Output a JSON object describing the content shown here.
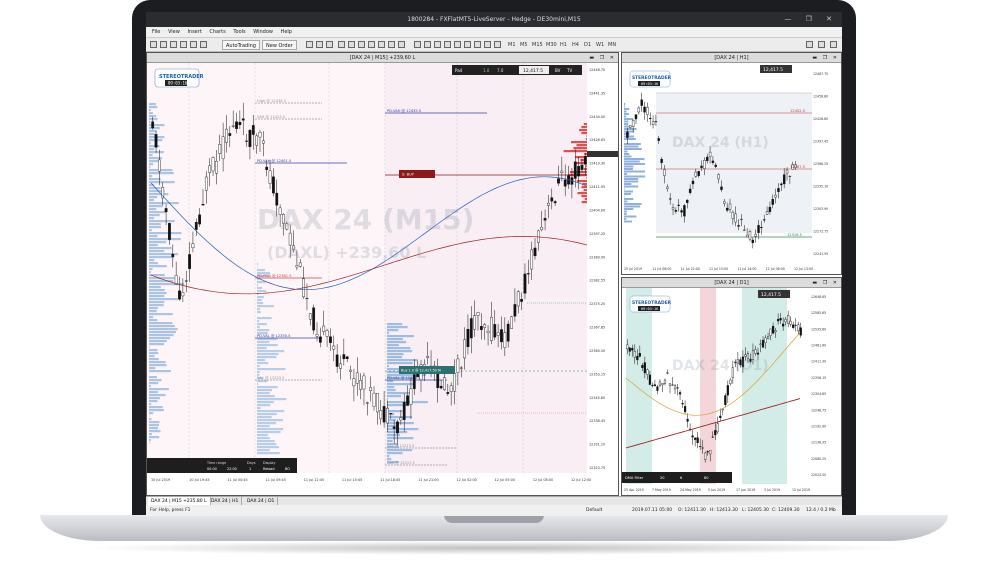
{
  "window": {
    "title": "1800284 - FXFlatMT5-LiveServer - Hedge - DE30mini,M15"
  },
  "menu": [
    "File",
    "View",
    "Insert",
    "Charts",
    "Tools",
    "Window",
    "Help"
  ],
  "toolbar": {
    "autotrading": "AutoTrading",
    "new_order": "New Order",
    "timeframes": [
      "M1",
      "M5",
      "M15",
      "M30",
      "H1",
      "H4",
      "D1",
      "W1",
      "MN"
    ]
  },
  "main_chart": {
    "header": "[DAX 24 | M15] +239,60 L",
    "watermark_line1": "DAX 24 (M15)",
    "watermark_line2": "(DAXL) +239,60 L",
    "logo": "STEREOTRADER",
    "timer": "09:03:16",
    "levels": [
      {
        "label": "High @ 12436.5",
        "color": "#999999"
      },
      {
        "label": "VAH @ 12423.5",
        "color": "#999999"
      },
      {
        "label": "PD-VAH @ 12435.5",
        "color": "#3344aa"
      },
      {
        "label": "PD-VAH @ 12401.5",
        "color": "#3344aa"
      },
      {
        "label": "PD-POC @ 12381.5",
        "color": "#cc4444"
      },
      {
        "label": "PD-VAL @ 12350.5",
        "color": "#3344aa"
      },
      {
        "label": "VAL @ 12333.5",
        "color": "#999999"
      },
      {
        "label": "PD-VAL @ 12333.5",
        "color": "#3344aa"
      },
      {
        "label": "VAL @ 12313.5",
        "color": "#999999"
      },
      {
        "label": "Low @ 12317.5",
        "color": "#999999"
      }
    ],
    "quick_panel": {
      "label": "Pa4",
      "price": "12,417.5",
      "sell": "1.0",
      "ratio": "7.0",
      "bv": "BV",
      "tv": "TV"
    },
    "buy_tag": "Buy 1.0 @ 12,417.50 M",
    "sell_tag": "S: BUY",
    "bottom_panel": {
      "time_range_label": "Time range",
      "time_from": "00:00",
      "time_to": "22:00",
      "days_label": "Days",
      "days_value": "1",
      "display_label": "Display",
      "reload": "Reload",
      "bo": "BO"
    },
    "price_axis": [
      "12448.70",
      "12441.35",
      "12434.00",
      "12426.65",
      "12419.30",
      "12411.95",
      "12404.60",
      "12397.25",
      "12389.90",
      "12382.55",
      "12375.20",
      "12367.85",
      "12360.50",
      "12353.15",
      "12345.80",
      "12338.45",
      "12331.10",
      "12323.75"
    ],
    "time_axis": [
      "10 Jul 2019",
      "10 Jul 19:45",
      "11 Jul 00:45",
      "11 Jul 09:45",
      "11 Jul 12:45",
      "11 Jul 15:45",
      "11 Jul 18:45",
      "11 Jul 21:00",
      "12 Jul 02:00",
      "12 Jul 05:00",
      "12 Jul 08:00",
      "12 Jul 12:00"
    ]
  },
  "h1_chart": {
    "header": "[DAX 24 | H1]",
    "watermark": "DAX 24 (H1)",
    "price": "12,417.5",
    "logo": "STEREOTRADER",
    "timer": "09:03:16",
    "mark1": "12452.5",
    "mark2": "12387.5",
    "mark3": "12316.5",
    "price_axis": [
      "12487.75",
      "12458.80",
      "12428.60",
      "12397.45",
      "12366.25",
      "12335.10",
      "12303.90",
      "12272.75",
      "12241.55"
    ],
    "time_axis": [
      "25 Jul 2019",
      "11 Jul 06:00",
      "11 Jul 22:00",
      "11 Jul 15:00",
      "11 Jul 14:00",
      "12 Jul 06:00",
      "12 Jul 13:00"
    ]
  },
  "d1_chart": {
    "header": "[DAX 24 | D1]",
    "watermark": "DAX 24 (D1)",
    "price": "12,417.5",
    "logo": "STEREOTRADER",
    "timer": "09:03:16",
    "panel": {
      "label": "DMA Filter",
      "v1": "20",
      "v2": "6",
      "v3": "80"
    },
    "price_axis": [
      "12648.65",
      "12585.65",
      "12535.60",
      "12481.60",
      "12411.30",
      "12356.15",
      "12304.65",
      "12248.75",
      "12192.90",
      "12136.35",
      "12080.25",
      "12024.50"
    ],
    "time_axis": [
      "25 Apr 2019",
      "7 May 2019",
      "24 May 2019",
      "5 Jun 2019",
      "17 Jun 2019",
      "3 Jul 2019",
      "12 Jul 2019"
    ]
  },
  "tabs": [
    "DAX 24 | M15 +235.80 L",
    "DAX 24 | H1",
    "DAX 24 | D1"
  ],
  "status": {
    "help": "For Help, press F1",
    "profile": "Default",
    "time": "2019.07.11 05:00",
    "open": "O: 12411.30",
    "high": "H: 12413.30",
    "low": "L: 12405.30",
    "close": "C: 12409.30",
    "traffic": "12.4 / 0.2 Mb"
  }
}
